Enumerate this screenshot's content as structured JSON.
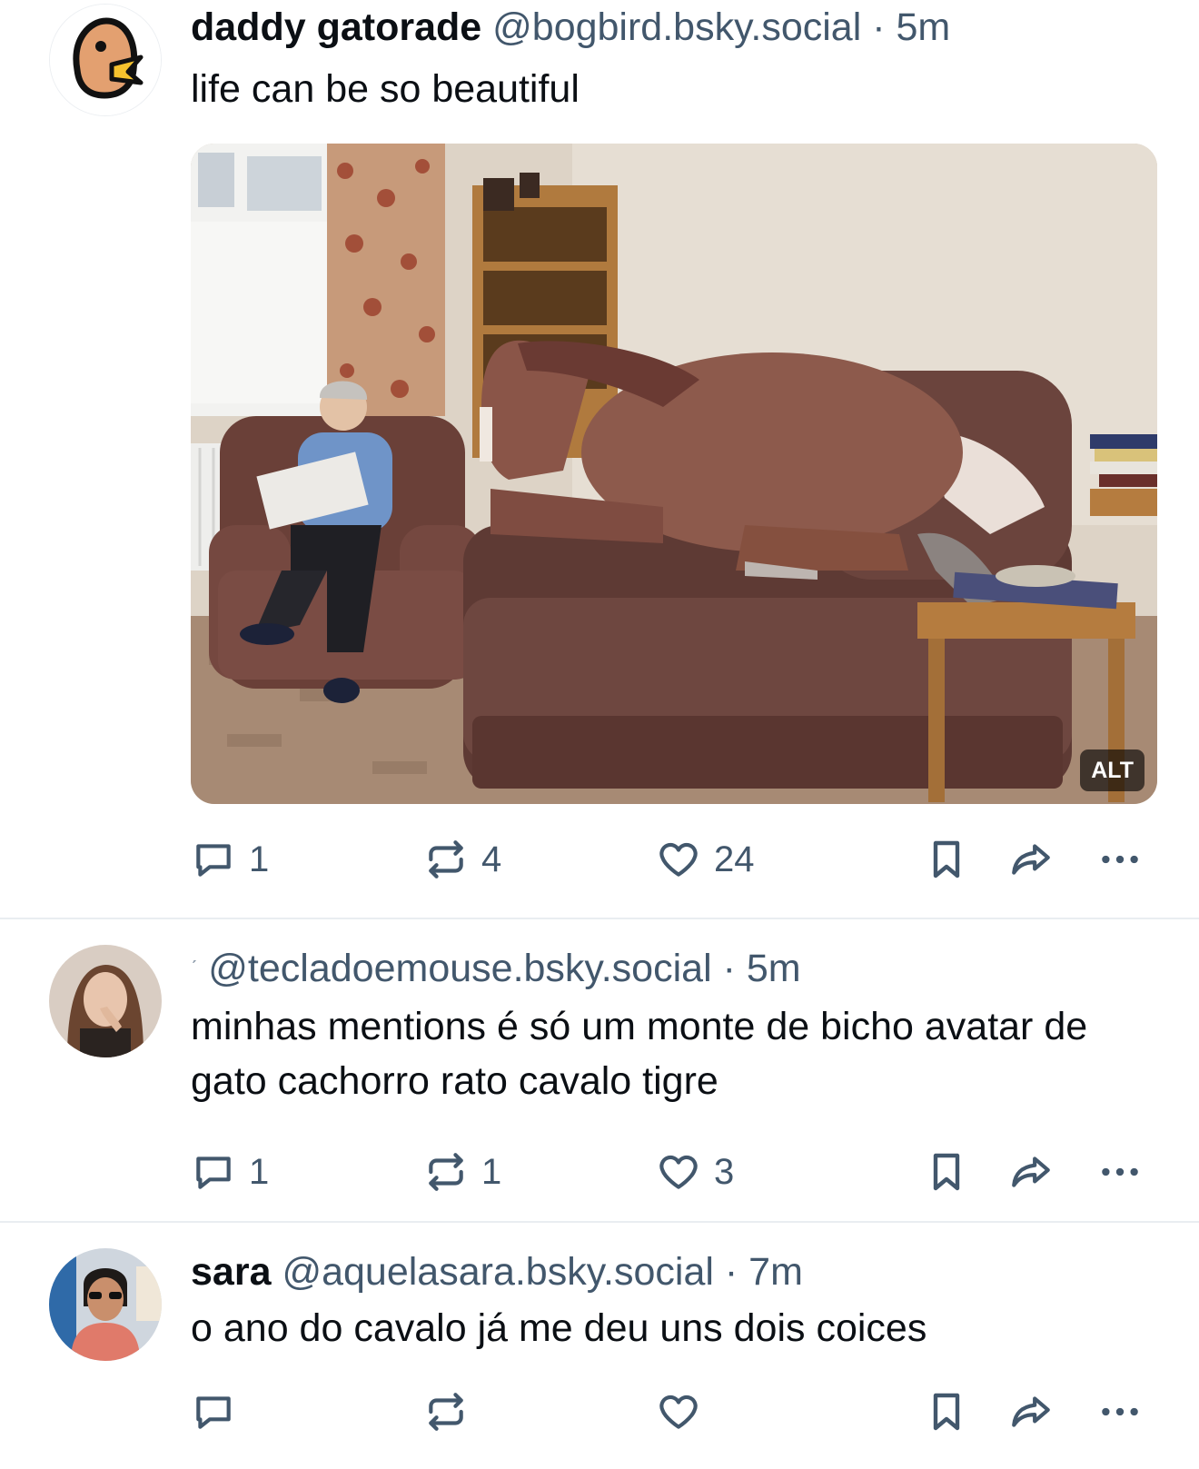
{
  "posts": [
    {
      "display_name": "daddy gatorade",
      "handle": "@bogbird.bsky.social",
      "separator": "·",
      "time": "5m",
      "text": "life can be so beautiful",
      "has_image": true,
      "image_alt_badge": "ALT",
      "replies": "1",
      "reposts": "4",
      "likes": "24"
    },
    {
      "display_name": "",
      "display_name_fragment": "ˊ",
      "handle": "@tecladoemouse.bsky.social",
      "separator": "·",
      "time": "5m",
      "text": "minhas mentions é só um monte de bicho avatar de gato cachorro rato cavalo tigre",
      "replies": "1",
      "reposts": "1",
      "likes": "3"
    },
    {
      "display_name": "sara",
      "handle": "@aquelasara.bsky.social",
      "separator": "·",
      "time": "7m",
      "text": "o ano do cavalo já me deu uns dois coices",
      "replies": "",
      "reposts": "",
      "likes": ""
    }
  ],
  "icons": {
    "reply": "speech-bubble-icon",
    "repost": "repost-arrows-icon",
    "like": "heart-icon",
    "bookmark": "bookmark-icon",
    "share": "share-arrow-icon",
    "more": "ellipsis-icon"
  },
  "colors": {
    "text_primary": "#0b0f14",
    "text_secondary": "#42576c",
    "divider": "#e9edf1"
  }
}
